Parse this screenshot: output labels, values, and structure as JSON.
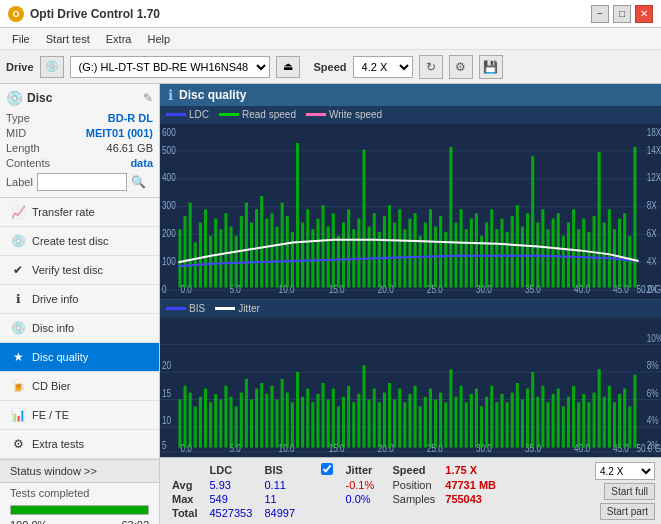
{
  "titleBar": {
    "title": "Opti Drive Control 1.70",
    "iconLabel": "O",
    "minimize": "−",
    "maximize": "□",
    "close": "✕"
  },
  "menuBar": {
    "items": [
      "File",
      "Start test",
      "Extra",
      "Help"
    ]
  },
  "driveBar": {
    "driveLabel": "Drive",
    "driveValue": "(G:)  HL-DT-ST BD-RE  WH16NS48 1.D3",
    "speedLabel": "Speed",
    "speedValue": "4.2 X"
  },
  "discInfo": {
    "type": {
      "label": "Type",
      "value": "BD-R DL"
    },
    "mid": {
      "label": "MID",
      "value": "MEIT01 (001)"
    },
    "length": {
      "label": "Length",
      "value": "46.61 GB"
    },
    "contents": {
      "label": "Contents",
      "value": "data"
    },
    "labelText": "Label"
  },
  "navItems": [
    {
      "id": "transfer-rate",
      "label": "Transfer rate",
      "icon": "📈"
    },
    {
      "id": "create-test-disc",
      "label": "Create test disc",
      "icon": "💿"
    },
    {
      "id": "verify-test-disc",
      "label": "Verify test disc",
      "icon": "✔"
    },
    {
      "id": "drive-info",
      "label": "Drive info",
      "icon": "ℹ"
    },
    {
      "id": "disc-info",
      "label": "Disc info",
      "icon": "💿"
    },
    {
      "id": "disc-quality",
      "label": "Disc quality",
      "icon": "★",
      "active": true
    },
    {
      "id": "cd-bier",
      "label": "CD Bier",
      "icon": "🍺"
    },
    {
      "id": "fe-te",
      "label": "FE / TE",
      "icon": "📊"
    },
    {
      "id": "extra-tests",
      "label": "Extra tests",
      "icon": "⚙"
    }
  ],
  "statusBar": {
    "statusWindowLabel": "Status window >>",
    "statusText": "Tests completed",
    "progressPercent": "100.0%",
    "timeValue": "63:02"
  },
  "chartHeader": {
    "title": "Disc quality"
  },
  "legend": {
    "topChart": {
      "ldc": "LDC",
      "read": "Read speed",
      "write": "Write speed"
    },
    "bottomChart": {
      "bis": "BIS",
      "jitter": "Jitter"
    }
  },
  "stats": {
    "columns": [
      "LDC",
      "BIS"
    ],
    "rows": [
      {
        "label": "Avg",
        "ldc": "5.93",
        "bis": "0.11",
        "jitter": "-0.1%"
      },
      {
        "label": "Max",
        "ldc": "549",
        "bis": "11",
        "jitter": "0.0%"
      },
      {
        "label": "Total",
        "ldc": "4527353",
        "bis": "84997",
        "jitter": ""
      }
    ],
    "jitterLabel": "Jitter",
    "speedLabel": "Speed",
    "speedValue": "1.75 X",
    "speedSelectValue": "4.2 X",
    "positionLabel": "Position",
    "positionValue": "47731 MB",
    "samplesLabel": "Samples",
    "samplesValue": "755043",
    "startFullLabel": "Start full",
    "startPartLabel": "Start part"
  }
}
